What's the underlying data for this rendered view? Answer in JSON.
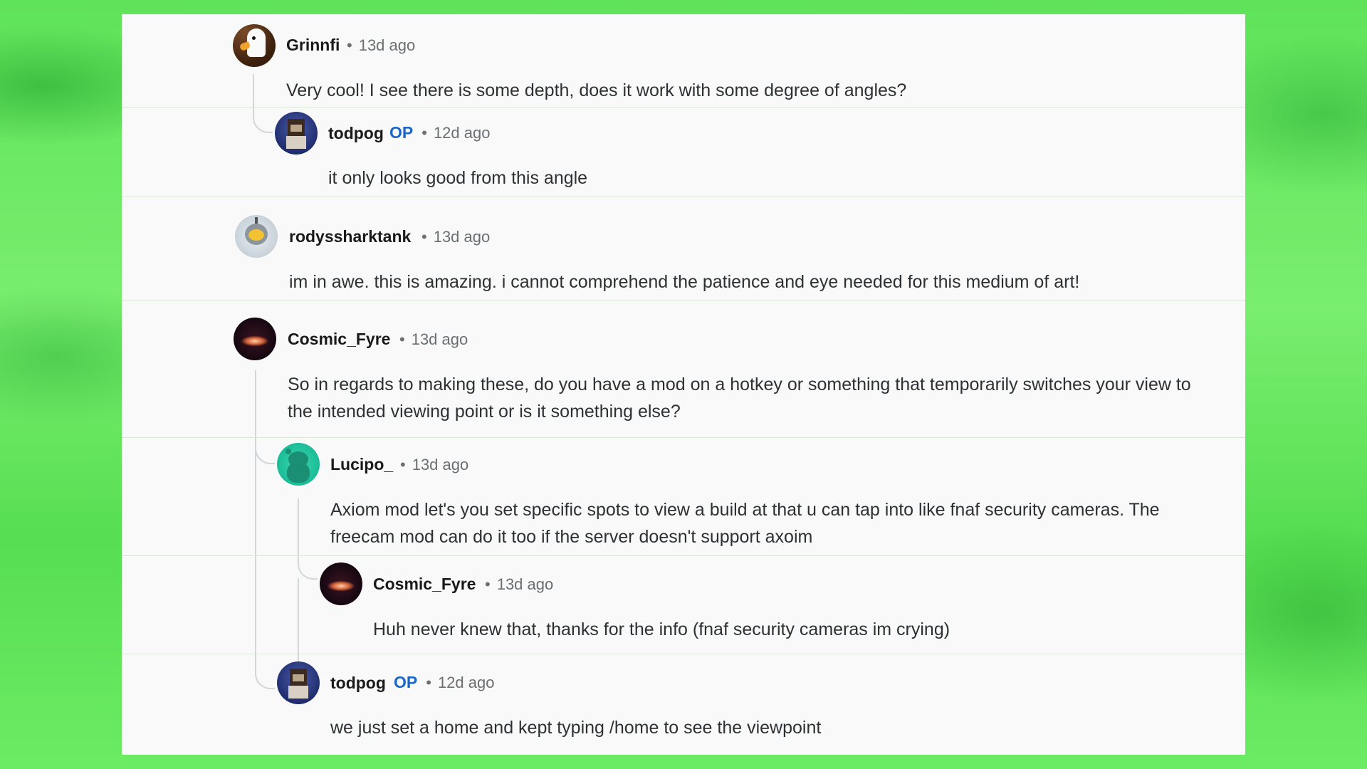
{
  "comments": [
    {
      "author": "Grinnfi",
      "time": "13d ago",
      "text": "Very cool! I see there is some depth, does it work with some degree of angles?"
    },
    {
      "author": "todpog",
      "op": "OP",
      "time": "12d ago",
      "text": "it only looks good from this angle"
    },
    {
      "author": "rodyssharktank",
      "time": "13d ago",
      "text": "im in awe. this is amazing. i cannot comprehend the patience and eye needed for this medium of art!"
    },
    {
      "author": "Cosmic_Fyre",
      "time": "13d ago",
      "text": "So in regards to making these, do you have a mod on a hotkey or something that temporarily switches your view to the intended viewing point or is it something else?"
    },
    {
      "author": "Lucipo_",
      "time": "13d ago",
      "text": "Axiom mod let's you set specific spots to view a build at that u can tap into like fnaf security cameras. The freecam mod can do it too if the server doesn't support axoim"
    },
    {
      "author": "Cosmic_Fyre",
      "time": "13d ago",
      "text": "Huh never knew that, thanks for the info (fnaf security cameras im crying)"
    },
    {
      "author": "todpog",
      "op": "OP",
      "time": "12d ago",
      "text": "we just set a home and kept typing /home to see the viewpoint"
    }
  ],
  "separator": "•",
  "colors": {
    "op": "#1b66c9",
    "background": "#66e65e",
    "card": "#f8f9f8"
  }
}
